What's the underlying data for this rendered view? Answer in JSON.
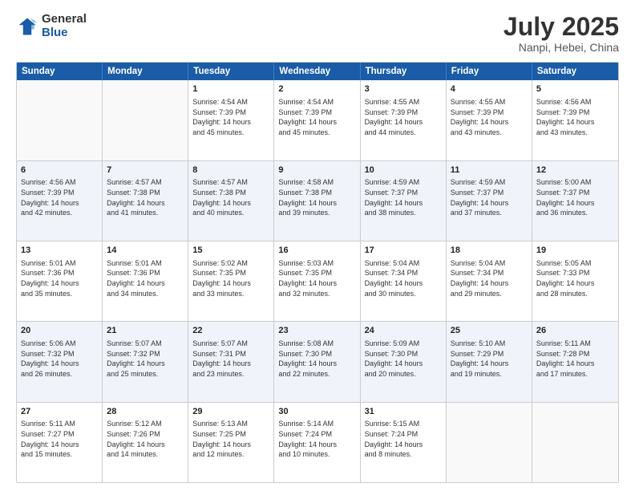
{
  "logo": {
    "general": "General",
    "blue": "Blue"
  },
  "title": {
    "month": "July 2025",
    "location": "Nanpi, Hebei, China"
  },
  "header_days": [
    "Sunday",
    "Monday",
    "Tuesday",
    "Wednesday",
    "Thursday",
    "Friday",
    "Saturday"
  ],
  "rows": [
    [
      {
        "day": "",
        "lines": []
      },
      {
        "day": "",
        "lines": []
      },
      {
        "day": "1",
        "lines": [
          "Sunrise: 4:54 AM",
          "Sunset: 7:39 PM",
          "Daylight: 14 hours",
          "and 45 minutes."
        ]
      },
      {
        "day": "2",
        "lines": [
          "Sunrise: 4:54 AM",
          "Sunset: 7:39 PM",
          "Daylight: 14 hours",
          "and 45 minutes."
        ]
      },
      {
        "day": "3",
        "lines": [
          "Sunrise: 4:55 AM",
          "Sunset: 7:39 PM",
          "Daylight: 14 hours",
          "and 44 minutes."
        ]
      },
      {
        "day": "4",
        "lines": [
          "Sunrise: 4:55 AM",
          "Sunset: 7:39 PM",
          "Daylight: 14 hours",
          "and 43 minutes."
        ]
      },
      {
        "day": "5",
        "lines": [
          "Sunrise: 4:56 AM",
          "Sunset: 7:39 PM",
          "Daylight: 14 hours",
          "and 43 minutes."
        ]
      }
    ],
    [
      {
        "day": "6",
        "lines": [
          "Sunrise: 4:56 AM",
          "Sunset: 7:39 PM",
          "Daylight: 14 hours",
          "and 42 minutes."
        ]
      },
      {
        "day": "7",
        "lines": [
          "Sunrise: 4:57 AM",
          "Sunset: 7:38 PM",
          "Daylight: 14 hours",
          "and 41 minutes."
        ]
      },
      {
        "day": "8",
        "lines": [
          "Sunrise: 4:57 AM",
          "Sunset: 7:38 PM",
          "Daylight: 14 hours",
          "and 40 minutes."
        ]
      },
      {
        "day": "9",
        "lines": [
          "Sunrise: 4:58 AM",
          "Sunset: 7:38 PM",
          "Daylight: 14 hours",
          "and 39 minutes."
        ]
      },
      {
        "day": "10",
        "lines": [
          "Sunrise: 4:59 AM",
          "Sunset: 7:37 PM",
          "Daylight: 14 hours",
          "and 38 minutes."
        ]
      },
      {
        "day": "11",
        "lines": [
          "Sunrise: 4:59 AM",
          "Sunset: 7:37 PM",
          "Daylight: 14 hours",
          "and 37 minutes."
        ]
      },
      {
        "day": "12",
        "lines": [
          "Sunrise: 5:00 AM",
          "Sunset: 7:37 PM",
          "Daylight: 14 hours",
          "and 36 minutes."
        ]
      }
    ],
    [
      {
        "day": "13",
        "lines": [
          "Sunrise: 5:01 AM",
          "Sunset: 7:36 PM",
          "Daylight: 14 hours",
          "and 35 minutes."
        ]
      },
      {
        "day": "14",
        "lines": [
          "Sunrise: 5:01 AM",
          "Sunset: 7:36 PM",
          "Daylight: 14 hours",
          "and 34 minutes."
        ]
      },
      {
        "day": "15",
        "lines": [
          "Sunrise: 5:02 AM",
          "Sunset: 7:35 PM",
          "Daylight: 14 hours",
          "and 33 minutes."
        ]
      },
      {
        "day": "16",
        "lines": [
          "Sunrise: 5:03 AM",
          "Sunset: 7:35 PM",
          "Daylight: 14 hours",
          "and 32 minutes."
        ]
      },
      {
        "day": "17",
        "lines": [
          "Sunrise: 5:04 AM",
          "Sunset: 7:34 PM",
          "Daylight: 14 hours",
          "and 30 minutes."
        ]
      },
      {
        "day": "18",
        "lines": [
          "Sunrise: 5:04 AM",
          "Sunset: 7:34 PM",
          "Daylight: 14 hours",
          "and 29 minutes."
        ]
      },
      {
        "day": "19",
        "lines": [
          "Sunrise: 5:05 AM",
          "Sunset: 7:33 PM",
          "Daylight: 14 hours",
          "and 28 minutes."
        ]
      }
    ],
    [
      {
        "day": "20",
        "lines": [
          "Sunrise: 5:06 AM",
          "Sunset: 7:32 PM",
          "Daylight: 14 hours",
          "and 26 minutes."
        ]
      },
      {
        "day": "21",
        "lines": [
          "Sunrise: 5:07 AM",
          "Sunset: 7:32 PM",
          "Daylight: 14 hours",
          "and 25 minutes."
        ]
      },
      {
        "day": "22",
        "lines": [
          "Sunrise: 5:07 AM",
          "Sunset: 7:31 PM",
          "Daylight: 14 hours",
          "and 23 minutes."
        ]
      },
      {
        "day": "23",
        "lines": [
          "Sunrise: 5:08 AM",
          "Sunset: 7:30 PM",
          "Daylight: 14 hours",
          "and 22 minutes."
        ]
      },
      {
        "day": "24",
        "lines": [
          "Sunrise: 5:09 AM",
          "Sunset: 7:30 PM",
          "Daylight: 14 hours",
          "and 20 minutes."
        ]
      },
      {
        "day": "25",
        "lines": [
          "Sunrise: 5:10 AM",
          "Sunset: 7:29 PM",
          "Daylight: 14 hours",
          "and 19 minutes."
        ]
      },
      {
        "day": "26",
        "lines": [
          "Sunrise: 5:11 AM",
          "Sunset: 7:28 PM",
          "Daylight: 14 hours",
          "and 17 minutes."
        ]
      }
    ],
    [
      {
        "day": "27",
        "lines": [
          "Sunrise: 5:11 AM",
          "Sunset: 7:27 PM",
          "Daylight: 14 hours",
          "and 15 minutes."
        ]
      },
      {
        "day": "28",
        "lines": [
          "Sunrise: 5:12 AM",
          "Sunset: 7:26 PM",
          "Daylight: 14 hours",
          "and 14 minutes."
        ]
      },
      {
        "day": "29",
        "lines": [
          "Sunrise: 5:13 AM",
          "Sunset: 7:25 PM",
          "Daylight: 14 hours",
          "and 12 minutes."
        ]
      },
      {
        "day": "30",
        "lines": [
          "Sunrise: 5:14 AM",
          "Sunset: 7:24 PM",
          "Daylight: 14 hours",
          "and 10 minutes."
        ]
      },
      {
        "day": "31",
        "lines": [
          "Sunrise: 5:15 AM",
          "Sunset: 7:24 PM",
          "Daylight: 14 hours",
          "and 8 minutes."
        ]
      },
      {
        "day": "",
        "lines": []
      },
      {
        "day": "",
        "lines": []
      }
    ]
  ]
}
